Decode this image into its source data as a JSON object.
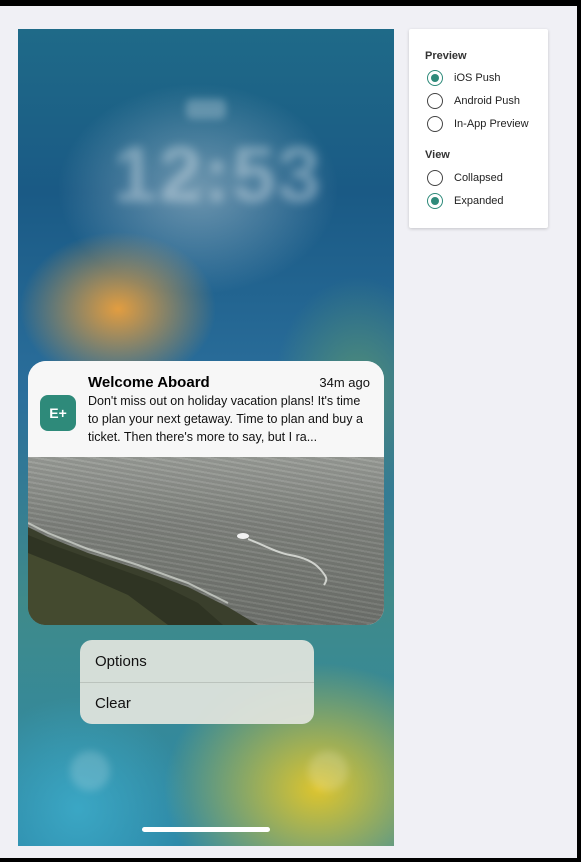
{
  "notification": {
    "app_icon_text": "E+",
    "title": "Welcome Aboard",
    "time": "34m ago",
    "body": "Don't miss out on holiday vacation plans! It's time to plan your next getaway. Time to plan and buy a ticket. Then there's more to say, but I ra..."
  },
  "menu": {
    "options_label": "Options",
    "clear_label": "Clear"
  },
  "panel": {
    "preview_title": "Preview",
    "preview_options": [
      {
        "label": "iOS Push",
        "checked": true
      },
      {
        "label": "Android Push",
        "checked": false
      },
      {
        "label": "In-App Preview",
        "checked": false
      }
    ],
    "view_title": "View",
    "view_options": [
      {
        "label": "Collapsed",
        "checked": false
      },
      {
        "label": "Expanded",
        "checked": true
      }
    ]
  },
  "colors": {
    "accent": "#2e8a7a"
  }
}
